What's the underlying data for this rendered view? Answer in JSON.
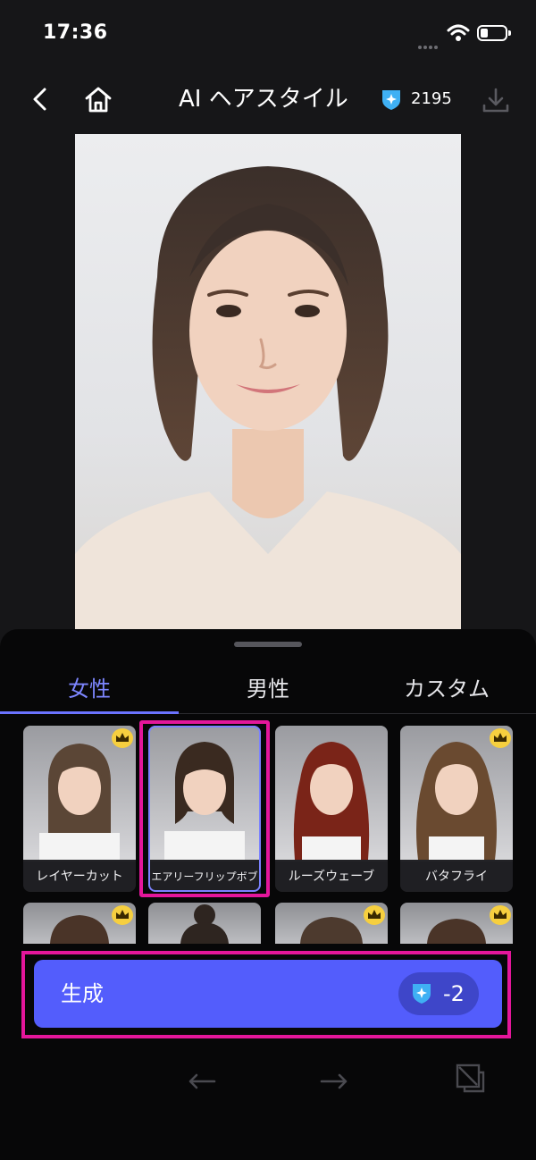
{
  "status_bar": {
    "time": "17:36"
  },
  "header": {
    "title": "AI ヘアスタイル",
    "credits": "2195",
    "icons": [
      "back-icon",
      "home-icon",
      "credit-gem-icon",
      "download-icon"
    ]
  },
  "main_photo": {
    "subject": "woman-portrait"
  },
  "tabs": [
    {
      "label": "女性",
      "active": true
    },
    {
      "label": "男性",
      "active": false
    },
    {
      "label": "カスタム",
      "active": false
    }
  ],
  "styles": [
    {
      "label": "レイヤーカット",
      "premium": true,
      "hair_color": "#5b4636"
    },
    {
      "label": "エアリーフリップボブ",
      "premium": false,
      "selected": true,
      "hair_color": "#3a2a20"
    },
    {
      "label": "ルーズウェーブ",
      "premium": false,
      "hair_color": "#7a2418"
    },
    {
      "label": "バタフライ",
      "premium": true,
      "hair_color": "#6a4a30"
    }
  ],
  "generate": {
    "label": "生成",
    "cost": "-2"
  },
  "colors": {
    "accent": "#535dfc",
    "tab_active": "#7d86ff",
    "highlight": "#e4169b",
    "crown": "#f6cf3f"
  }
}
